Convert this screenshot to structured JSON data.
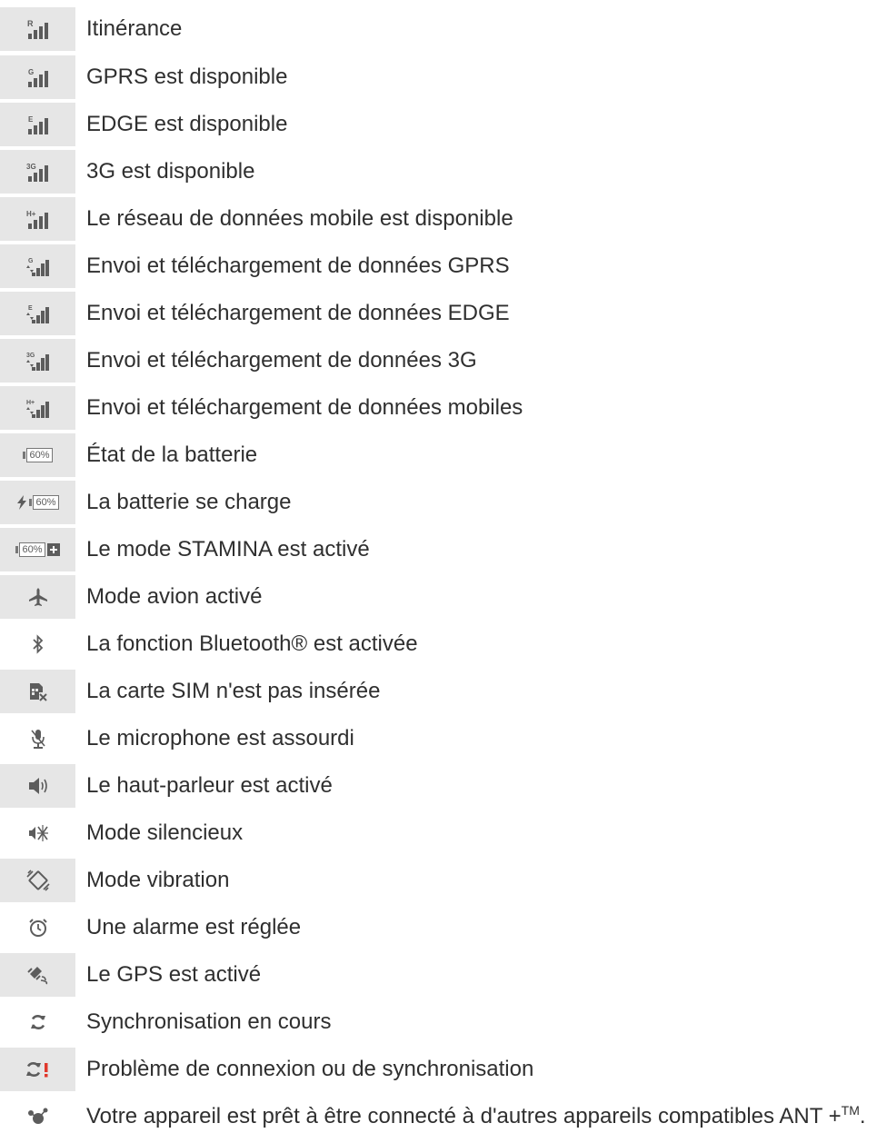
{
  "rows": [
    {
      "icon": "signal-roaming-icon",
      "text": "Itinérance"
    },
    {
      "icon": "signal-gprs-icon",
      "text": "GPRS est disponible"
    },
    {
      "icon": "signal-edge-icon",
      "text": "EDGE est disponible"
    },
    {
      "icon": "signal-3g-icon",
      "text": "3G est disponible"
    },
    {
      "icon": "signal-hplus-icon",
      "text": "Le réseau de données mobile est disponible"
    },
    {
      "icon": "signal-gprs-transfer-icon",
      "text": "Envoi et téléchargement de données GPRS"
    },
    {
      "icon": "signal-edge-transfer-icon",
      "text": "Envoi et téléchargement de données EDGE"
    },
    {
      "icon": "signal-3g-transfer-icon",
      "text": "Envoi et téléchargement de données 3G"
    },
    {
      "icon": "signal-hplus-transfer-icon",
      "text": "Envoi et téléchargement de données mobiles"
    },
    {
      "icon": "battery-icon",
      "text": "État de la batterie"
    },
    {
      "icon": "battery-charging-icon",
      "text": "La batterie se charge"
    },
    {
      "icon": "battery-stamina-icon",
      "text": "Le mode STAMINA est activé"
    },
    {
      "icon": "airplane-icon",
      "text": "Mode avion activé"
    },
    {
      "icon": "bluetooth-icon",
      "text": "La fonction Bluetooth® est activée"
    },
    {
      "icon": "no-sim-icon",
      "text": "La carte SIM n'est pas insérée"
    },
    {
      "icon": "mic-muted-icon",
      "text": "Le microphone est assourdi"
    },
    {
      "icon": "speaker-icon",
      "text": "Le haut-parleur est activé"
    },
    {
      "icon": "silent-mode-icon",
      "text": "Mode silencieux"
    },
    {
      "icon": "vibrate-mode-icon",
      "text": "Mode vibration"
    },
    {
      "icon": "alarm-icon",
      "text": "Une alarme est réglée"
    },
    {
      "icon": "gps-icon",
      "text": "Le GPS est activé"
    },
    {
      "icon": "sync-icon",
      "text": "Synchronisation en cours"
    },
    {
      "icon": "sync-error-icon",
      "text": "Problème de connexion ou de synchronisation"
    },
    {
      "icon": "ant-plus-icon",
      "text": "Votre appareil est prêt à être connecté à d'autres appareils compatibles ANT"
    }
  ],
  "last_row_tail": "+",
  "last_row_tm": "TM",
  "last_row_end": ".",
  "battery_level": "60%",
  "signal_letters": {
    "roaming": "R",
    "gprs": "G",
    "edge": "E",
    "threeg": "3G",
    "hplus": "H+"
  },
  "colors": {
    "icon_bg": "#e6e6e6",
    "icon_fg": "#5c5c5c",
    "text": "#2f2f2f",
    "alert": "#e0382c"
  }
}
